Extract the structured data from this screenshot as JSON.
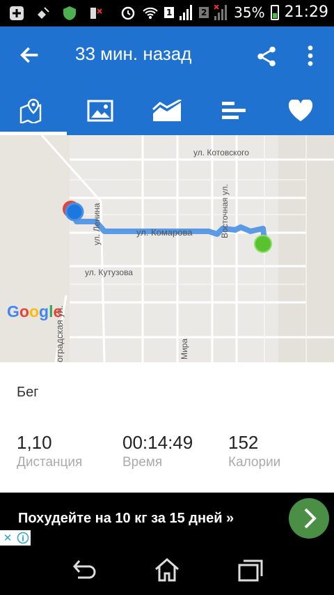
{
  "status_bar": {
    "sim1": "1",
    "sim2": "2",
    "battery": "35%",
    "time": "21:29"
  },
  "app_bar": {
    "title": "33 мин. назад",
    "back_icon": "arrow-left-icon",
    "share_icon": "share-icon",
    "more_icon": "more-vert-icon"
  },
  "tabs": [
    {
      "icon": "map-icon",
      "active": true
    },
    {
      "icon": "photo-icon",
      "active": false
    },
    {
      "icon": "chart-icon",
      "active": false
    },
    {
      "icon": "bars-icon",
      "active": false
    },
    {
      "icon": "heart-icon",
      "active": false
    }
  ],
  "map": {
    "streets": {
      "kotovskogo": "ул. Котовского",
      "vostochnaya": "Восточная ул.",
      "lenina": "ул. Ленина",
      "komarova": "ул. Комарова",
      "kutuzova": "ул. Кутузова",
      "grad": "оградская ул.",
      "mira": "Мира"
    },
    "logo": "Google",
    "colors": {
      "route": "#4a90e2",
      "start": "#5ac12f",
      "end": "#e2453c"
    }
  },
  "workout": {
    "activity": "Бег",
    "distance_value": "1,10",
    "distance_label": "Дистанция",
    "time_value": "00:14:49",
    "time_label": "Время",
    "calories_value": "152",
    "calories_label": "Калории"
  },
  "ad": {
    "text": "Похудейте на 10 кг за 15 дней »",
    "close": "✕",
    "info": "i"
  },
  "nav": {
    "back_icon": "nav-back-icon",
    "home_icon": "home-icon",
    "recents_icon": "recents-icon"
  },
  "colors": {
    "accent": "#1f72d0"
  }
}
